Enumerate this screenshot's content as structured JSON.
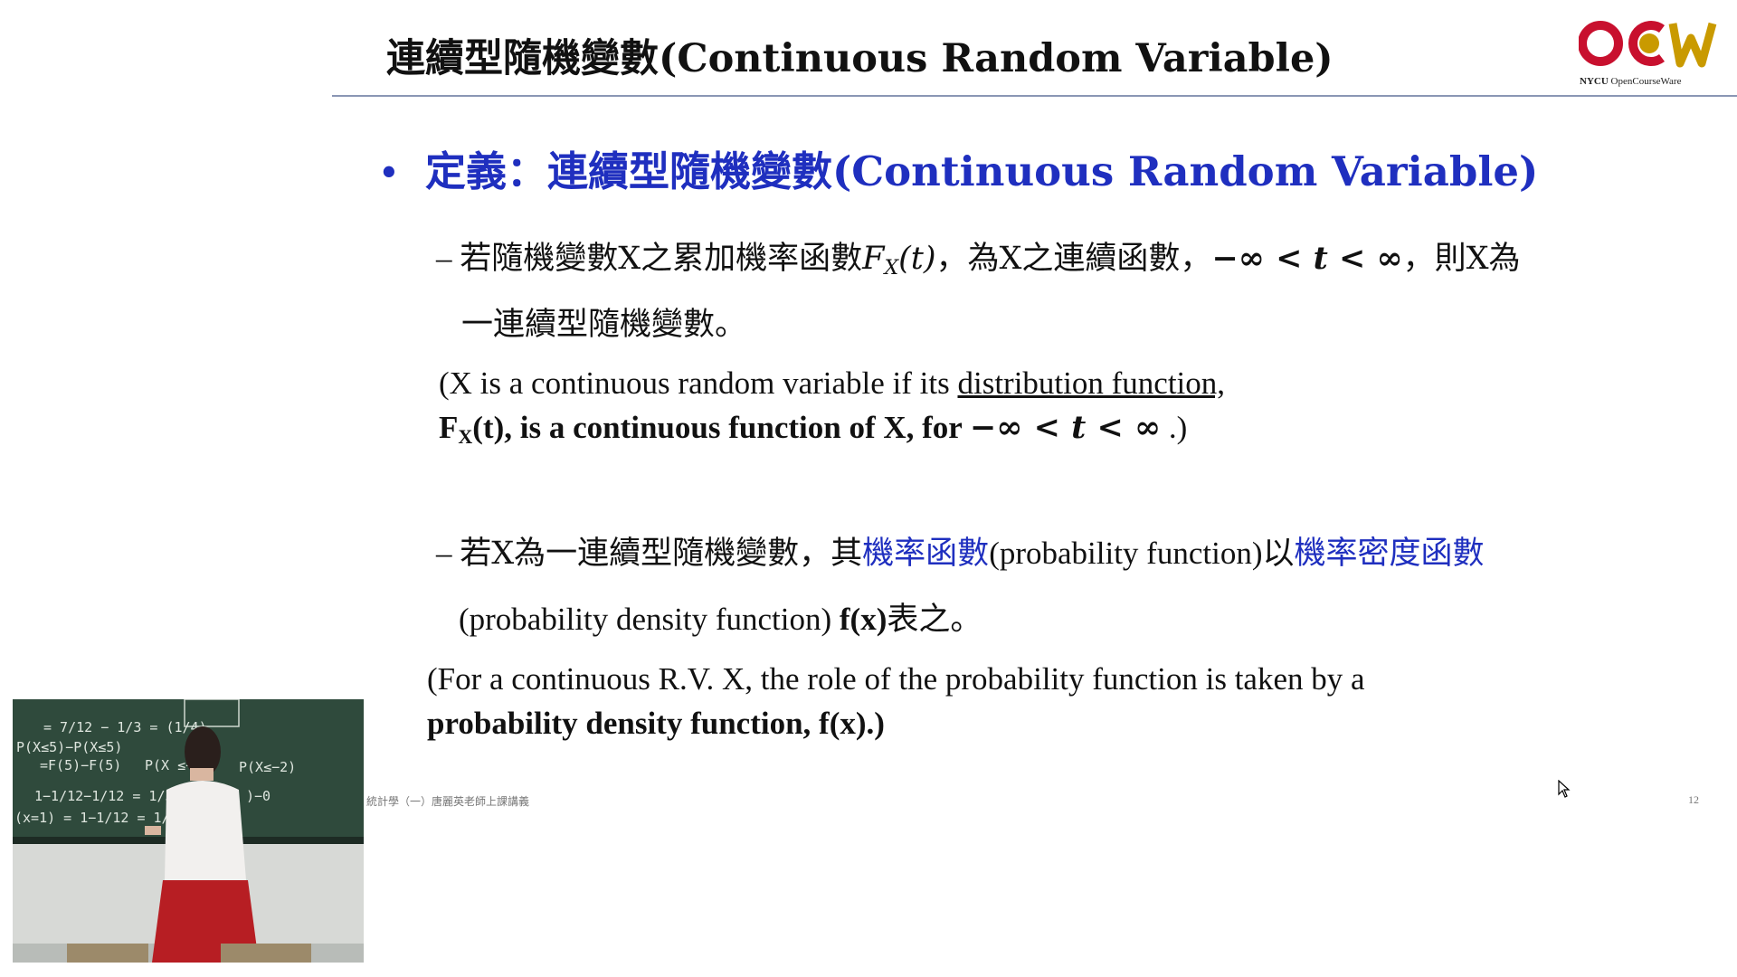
{
  "slide": {
    "title": "連續型隨機變數(Continuous Random Variable)",
    "logo": {
      "brand": "OCW",
      "caption_bold": "NYCU",
      "caption_rest": " OpenCourseWare"
    },
    "bullet": {
      "prefix": "定義：",
      "text": "連續型隨機變數(Continuous Random Variable)"
    },
    "dash": "–",
    "item1": {
      "part1": "若隨機變數X之累加機率函數",
      "func_F": "F",
      "func_sub": "X",
      "func_arg": "(t)",
      "part2": "，為X之連續函數，",
      "range": "−∞ < t < ∞",
      "part3": "，則X為",
      "line2": "一連續型隨機變數。"
    },
    "english1": {
      "l1_pre": "(X is a continuous random variable if its ",
      "l1_ul": "distribution function,",
      "l2_F": "F",
      "l2_sub": "X",
      "l2_bold": "(t), is a continuous function of X, for ",
      "l2_range": "−∞ < t < ∞",
      "l2_end": " .)"
    },
    "item2": {
      "part1": "若X為一連續型隨機變數，其",
      "blue1": "機率函數",
      "part2": "(probability function)",
      "part3": "以",
      "blue2": "機率密度函數",
      "line2_pre": "(probability density function) ",
      "line2_bold": "f(x)",
      "line2_end": "表之。"
    },
    "english2": {
      "l1": "(For a continuous R.V. X, the role of the probability function  is taken by a",
      "l2": "probability density function, f(x).)"
    },
    "footer": "統計學（一）唐麗英老師上課講義",
    "page_number": "12"
  },
  "video": {
    "board_text": [
      "= 7/12 − 1/3 = (1/4)",
      "=F(5)−F(5)",
      "P(X≤5)−P(X≤5)",
      "1−1/12−1/12 = 1/3",
      "(x=1) = 1−1/12 = 1/12",
      "P(X ≤−2)",
      "P(X≤−2)",
      ")−0"
    ]
  },
  "colors": {
    "accent_blue": "#1f2fbf",
    "logo_red": "#c8102e",
    "logo_gold": "#c99a00",
    "rule": "#8a96b4",
    "board": "#2f4a3c"
  }
}
